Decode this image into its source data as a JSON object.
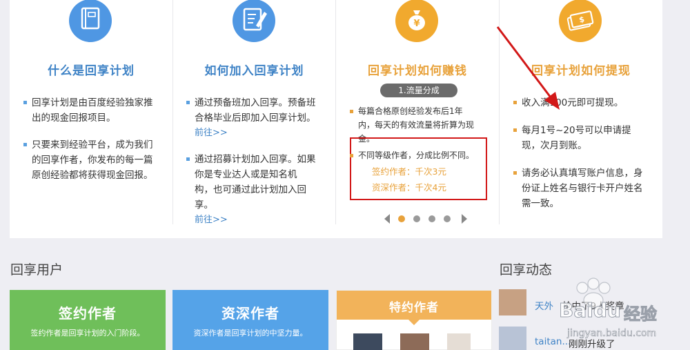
{
  "columns": [
    {
      "title": "什么是回享计划",
      "icon": "book-icon",
      "bullets": [
        {
          "lines": [
            "回享计划是由百度经验独家推",
            "出的现金回报项目。"
          ]
        },
        {
          "lines": [
            "只要来到经验平台，成为我们",
            "的回享作者，你发布的每一篇",
            "原创经验都将获得现金回报。"
          ]
        }
      ]
    },
    {
      "title": "如何加入回享计划",
      "icon": "edit-document-icon",
      "bullets": [
        {
          "lines": [
            "通过预备班加入回享。预备班",
            "合格毕业后即加入回享计划。"
          ],
          "link": "前往>>"
        },
        {
          "lines": [
            "通过招募计划加入回享。如果",
            "你是专业达人或是知名机",
            "构，也可通过此计划加入回",
            "享。"
          ],
          "link": "前往>>"
        }
      ]
    },
    {
      "title": "回享计划如何赚钱",
      "icon": "money-bag-icon",
      "pill": "1.流量分成",
      "bullet_lines": [
        "每篇合格原创经验发布后1年",
        "内，每天的有效流量将折算为现",
        "金。"
      ],
      "box_line": "不同等级作者，分成比例不同。",
      "tiers": [
        "签约作者：千次3元",
        "资深作者：千次4元"
      ],
      "pager": {
        "count": 4,
        "active": 1
      }
    },
    {
      "title": "回享计划如何提现",
      "icon": "cash-icon",
      "bullets": [
        {
          "lines": [
            "收入满100元即可提现。"
          ]
        },
        {
          "lines": [
            "每月1号~20号可以申请提",
            "现，次月到账。"
          ]
        },
        {
          "lines": [
            "请务必认真填写账户信息，身",
            "份证上姓名与银行卡开户姓名",
            "需一致。"
          ]
        }
      ]
    }
  ],
  "users_section": {
    "title": "回享用户",
    "cards": [
      {
        "title": "签约作者",
        "subtitle": "签约作者是回享计划的入门阶段。"
      },
      {
        "title": "资深作者",
        "subtitle": "资深作者是回享计划的中坚力量。"
      },
      {
        "title": "特约作者"
      }
    ]
  },
  "feed_section": {
    "title": "回享动态",
    "items": [
      {
        "user": "天外",
        "text": "抢中了9人奖章"
      },
      {
        "user": "taitan...",
        "text": "刚刚升级了"
      }
    ]
  },
  "watermark": {
    "brand": "Baidu",
    "cn": "经验",
    "url": "jingyan.baidu.com"
  },
  "colors": {
    "blue": "#3f83c6",
    "orange": "#e8a23b",
    "green": "#6fbf5a",
    "sky": "#55a3e8",
    "red_annotation": "#d21818"
  }
}
